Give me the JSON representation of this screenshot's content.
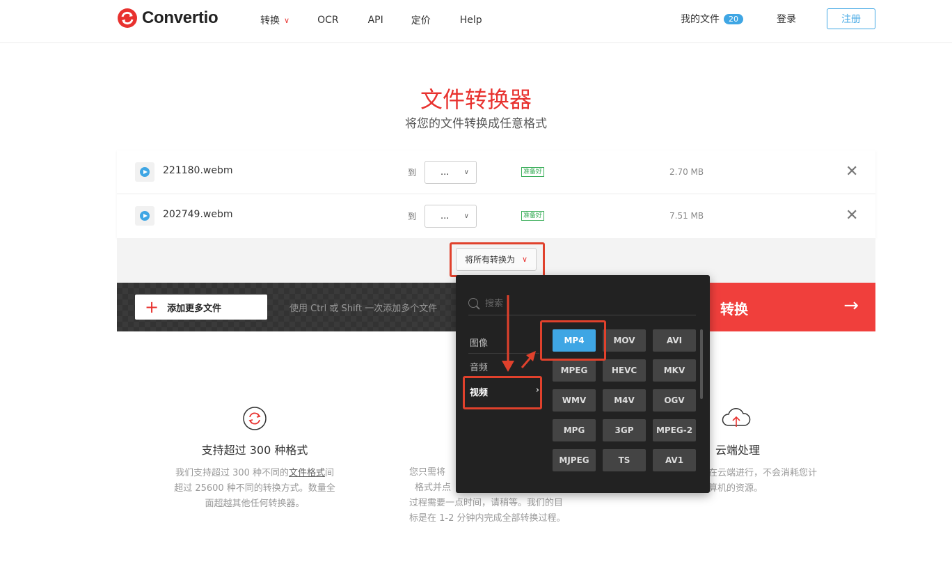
{
  "header": {
    "logo_text": "Convertio",
    "nav": {
      "convert": "转换",
      "ocr": "OCR",
      "api": "API",
      "pricing": "定价",
      "help": "Help"
    },
    "my_files": "我的文件",
    "my_files_count": "20",
    "login": "登录",
    "signup": "注册"
  },
  "hero": {
    "title": "文件转换器",
    "subtitle": "将您的文件转换成任意格式"
  },
  "files": [
    {
      "name": "221180.webm",
      "to_label": "到",
      "format": "...",
      "status": "准备好",
      "size": "2.70 MB"
    },
    {
      "name": "202749.webm",
      "to_label": "到",
      "format": "...",
      "status": "准备好",
      "size": "7.51 MB"
    }
  ],
  "convert_all": {
    "label": "将所有转换为"
  },
  "actions": {
    "add_files": "添加更多文件",
    "add_hint": "使用 Ctrl 或 Shift 一次添加多个文件",
    "convert": "转换"
  },
  "dropdown": {
    "search_placeholder": "搜索",
    "categories": [
      "图像",
      "音频",
      "视频"
    ],
    "formats": [
      "MP4",
      "MOV",
      "AVI",
      "MPEG",
      "HEVC",
      "MKV",
      "WMV",
      "M4V",
      "OGV",
      "MPG",
      "3GP",
      "MPEG-2",
      "MJPEG",
      "TS",
      "AV1"
    ],
    "selected_format": "MP4"
  },
  "features": {
    "f1": {
      "title": "支持超过 300 种格式",
      "desc_a": "我们支持超过 300 种不同的",
      "desc_link": "文件格式",
      "desc_b": "间超过 25600 种不同的转换方式。数量全面超越其他任何转换器。"
    },
    "f2": {
      "desc_l1": "您只需将",
      "desc_l2": "格式并点",
      "desc_l3": "过程需要一点时间，请稍等。我们的目",
      "desc_l4": "标是在 1-2 分钟内完成全部转换过程。"
    },
    "f3": {
      "title": "云端处理",
      "desc_l1": "在云端进行，不会消耗您计",
      "desc_l2": "算机的资源。"
    }
  },
  "colors": {
    "brand_red": "#e8322f",
    "accent_blue": "#3fa6e4",
    "ready_green": "#3bae5a",
    "highlight": "#e0412c"
  }
}
